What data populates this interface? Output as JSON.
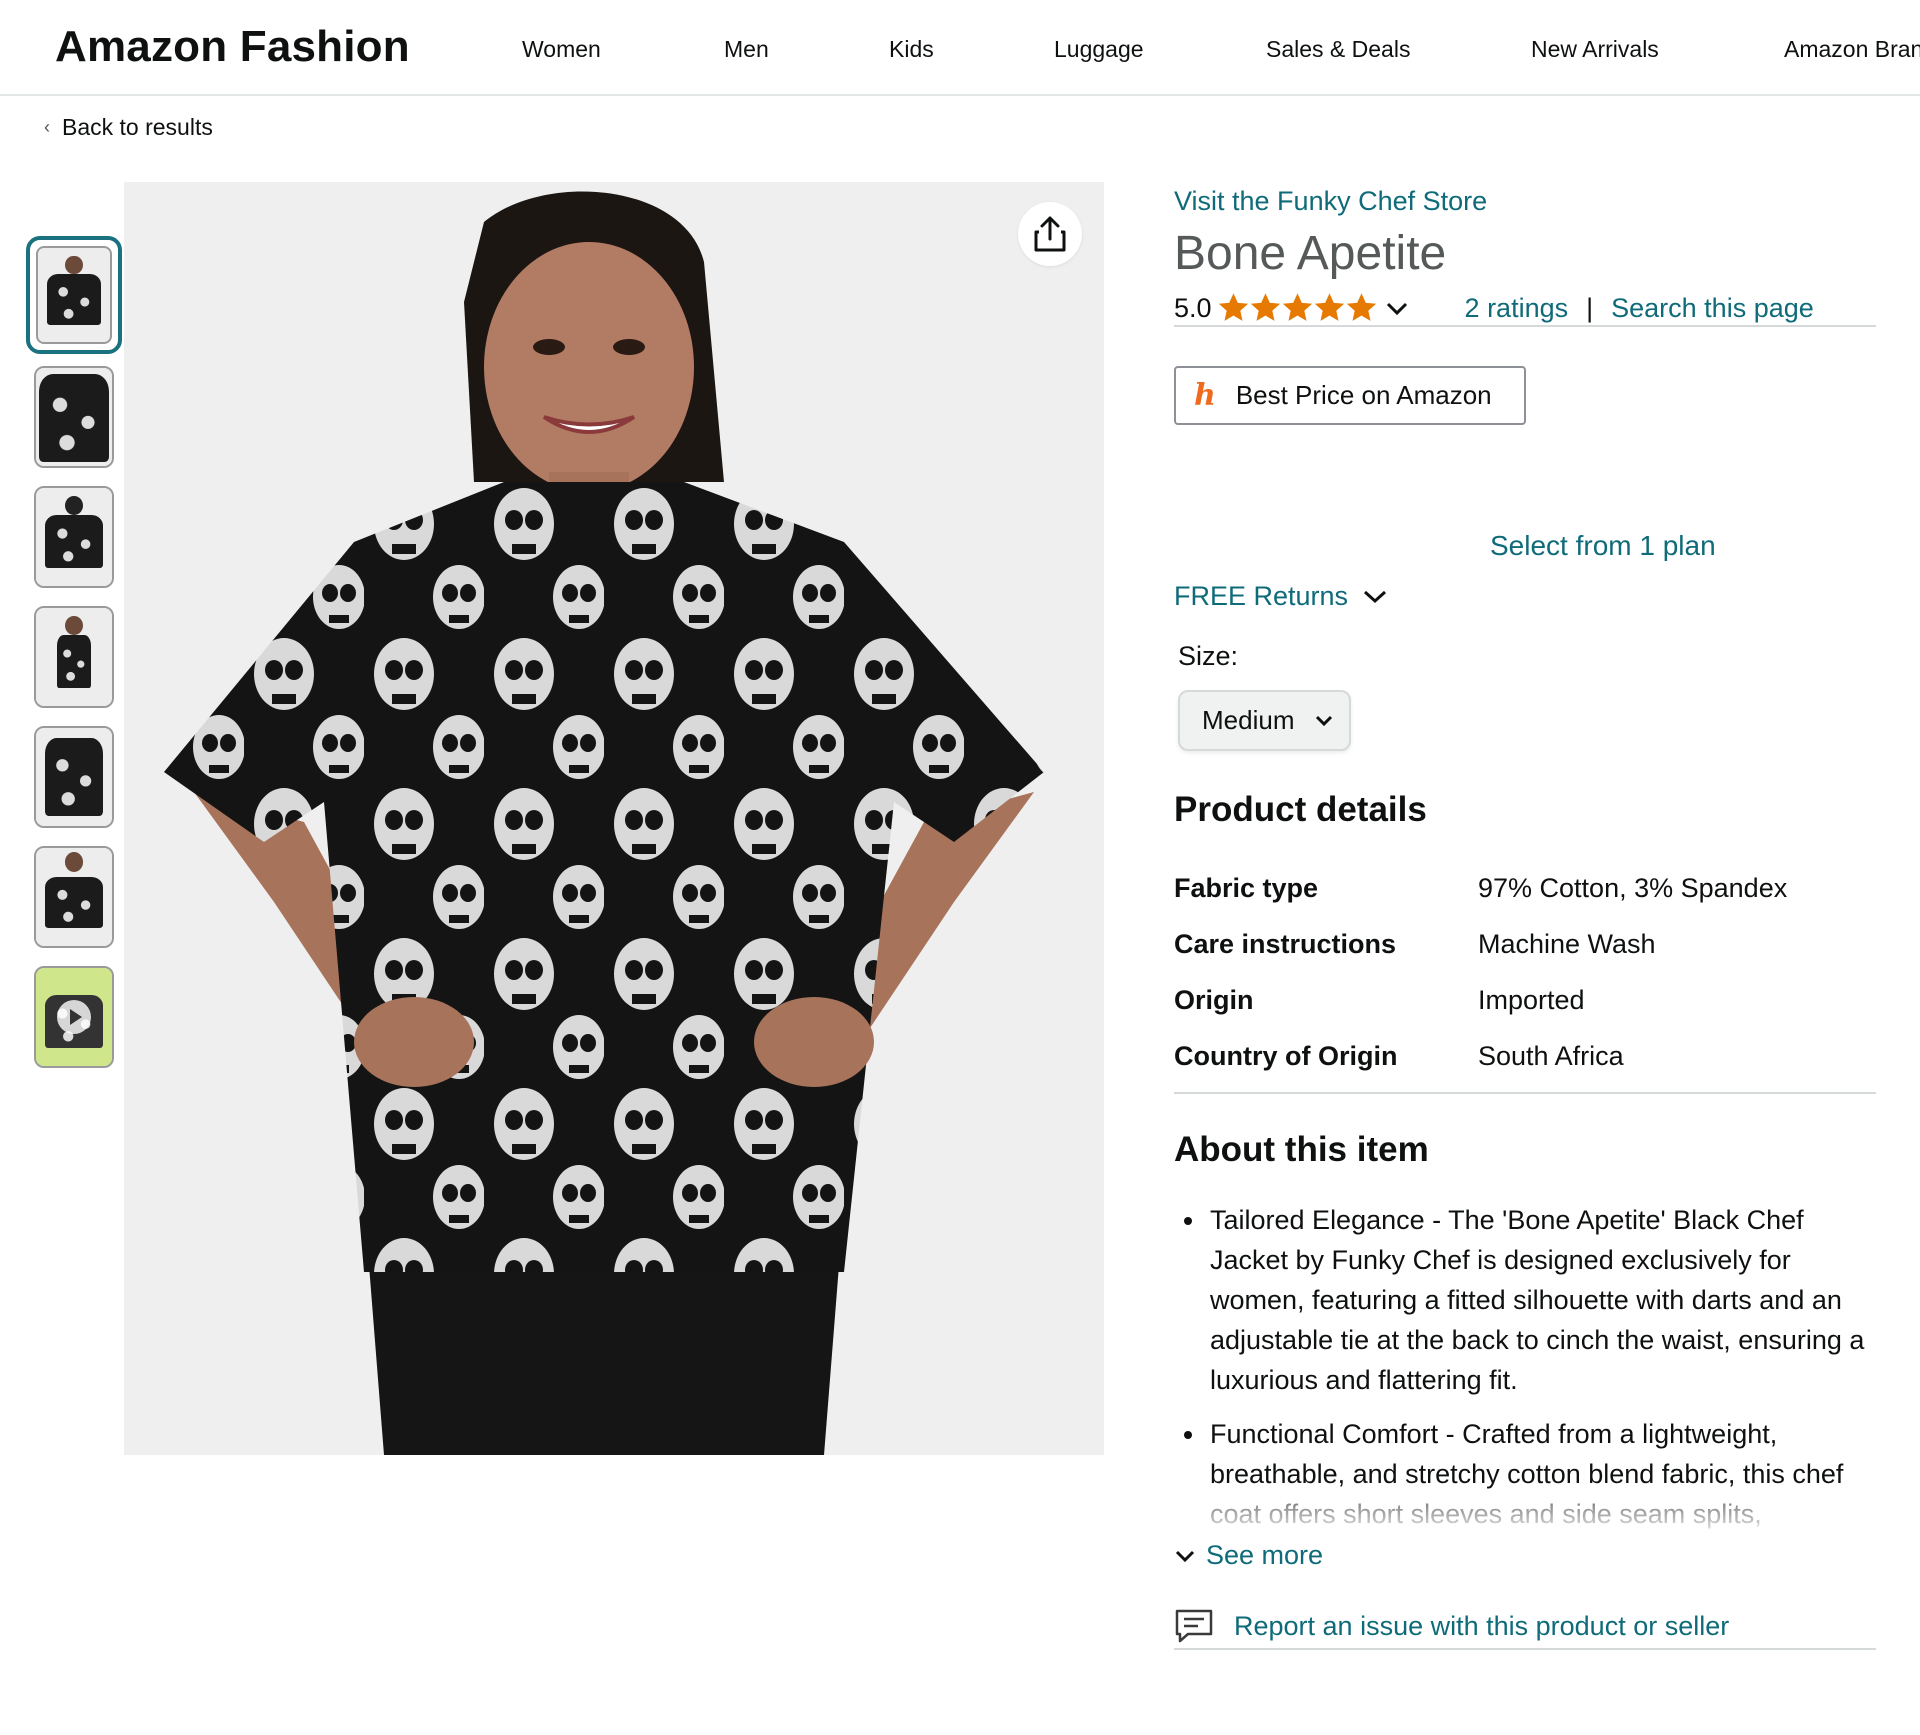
{
  "brand": "Amazon Fashion",
  "nav": [
    "Women",
    "Men",
    "Kids",
    "Luggage",
    "Sales & Deals",
    "New Arrivals",
    "Amazon Brands"
  ],
  "back_link": "Back to results",
  "product": {
    "store_link": "Visit the Funky Chef Store",
    "title": "Bone Apetite",
    "rating_value": "5.0",
    "stars_filled": 5,
    "ratings_link": "2 ratings",
    "separator": "|",
    "search_link": "Search this page",
    "price_button": "Best Price on Amazon",
    "plan_link": "Select from 1 plan",
    "returns": "FREE Returns",
    "size_label": "Size:",
    "size_value": "Medium"
  },
  "details_heading": "Product details",
  "details": [
    {
      "key": "Fabric type",
      "value": "97% Cotton, 3% Spandex"
    },
    {
      "key": "Care instructions",
      "value": "Machine Wash"
    },
    {
      "key": "Origin",
      "value": "Imported"
    },
    {
      "key": "Country of Origin",
      "value": "South Africa"
    }
  ],
  "about_heading": "About this item",
  "about": [
    "Tailored Elegance - The 'Bone Apetite' Black Chef Jacket by Funky Chef is designed exclusively for women, featuring a fitted silhouette with darts and an adjustable tie at the back to cinch the waist, ensuring a luxurious and flattering fit.",
    "Functional Comfort - Crafted from a lightweight, breathable, and stretchy cotton blend fabric, this chef coat offers short sleeves and side seam splits,"
  ],
  "see_more": "See more",
  "report_link": "Report an issue with this product or seller",
  "colors": {
    "link": "#0f6b79",
    "star": "#e67a00",
    "selected_thumb": "#1a7180",
    "price_logo": "#ef6a1d"
  },
  "thumbnail_count": 7
}
